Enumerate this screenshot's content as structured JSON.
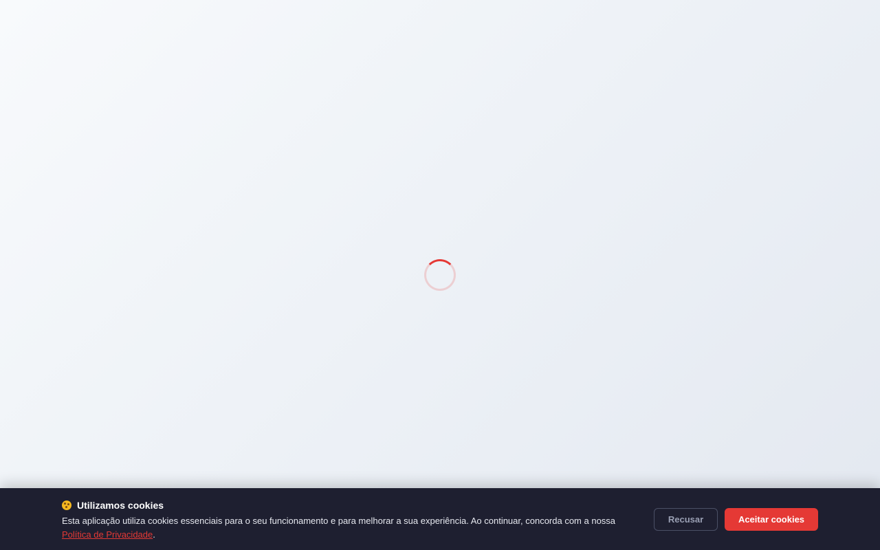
{
  "loader": {
    "accent_color": "#e53935",
    "icon": "loading-spinner"
  },
  "cookie_banner": {
    "icon": "cookie-icon",
    "title": "Utilizamos cookies",
    "description": "Esta aplicação utiliza cookies essenciais para o seu funcionamento e para melhorar a sua experiência. Ao continuar, concorda com a nossa ",
    "policy_link": "Política de Privacidade",
    "description_end": ".",
    "decline_label": "Recusar",
    "accept_label": "Aceitar cookies",
    "background_color": "#1e1f30",
    "accept_color": "#e53935"
  }
}
